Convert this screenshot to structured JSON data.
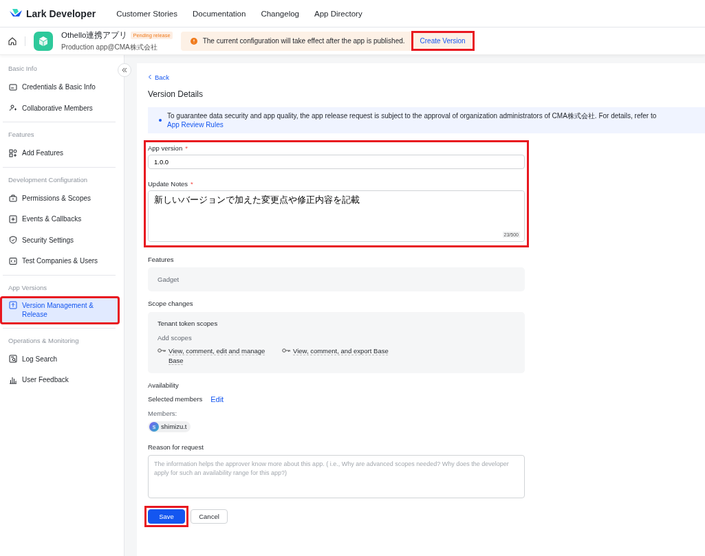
{
  "header": {
    "brand": "Lark Developer",
    "nav": [
      "Customer Stories",
      "Documentation",
      "Changelog",
      "App Directory"
    ]
  },
  "app_bar": {
    "app_name": "Othello連携アプリ",
    "status_badge": "Pending release",
    "subtitle": "Production app@CMA株式会社",
    "notice": "The current configuration will take effect after the app is published.",
    "action": {
      "label": "Create Version",
      "highlighted": true
    }
  },
  "sidebar": {
    "sections": [
      {
        "title": "Basic Info",
        "items": [
          {
            "label": "Credentials & Basic Info",
            "selected": false,
            "highlighted": false
          },
          {
            "label": "Collaborative Members",
            "selected": false,
            "highlighted": false
          }
        ]
      },
      {
        "title": "Features",
        "items": [
          {
            "label": "Add Features",
            "selected": false,
            "highlighted": false
          }
        ]
      },
      {
        "title": "Development Configuration",
        "items": [
          {
            "label": "Permissions & Scopes",
            "selected": false,
            "highlighted": false
          },
          {
            "label": "Events & Callbacks",
            "selected": false,
            "highlighted": false
          },
          {
            "label": "Security Settings",
            "selected": false,
            "highlighted": false
          },
          {
            "label": "Test Companies & Users",
            "selected": false,
            "highlighted": false
          }
        ]
      },
      {
        "title": "App Versions",
        "items": [
          {
            "label": "Version Management & Release",
            "selected": true,
            "highlighted": true
          }
        ]
      },
      {
        "title": "Operations & Monitoring",
        "items": [
          {
            "label": "Log Search",
            "selected": false,
            "highlighted": false
          },
          {
            "label": "User Feedback",
            "selected": false,
            "highlighted": false
          }
        ]
      }
    ]
  },
  "main": {
    "back": "Back",
    "title": "Version Details",
    "notice": {
      "text": "To guarantee data security and app quality, the app release request is subject to the approval of organization administrators of CMA株式会社. For details, refer to",
      "link": "App Review Rules"
    },
    "form": {
      "highlighted": true,
      "fields": [
        {
          "kind": "input",
          "label": "App version",
          "required_mark": "*",
          "value": "1.0.0"
        },
        {
          "kind": "textarea",
          "label": "Update Notes",
          "required_mark": "*",
          "value": "新しいバージョンで加えた変更点や修正内容を記載",
          "counter": "23/500"
        }
      ]
    },
    "features": {
      "label": "Features",
      "items": [
        "Gadget"
      ]
    },
    "scope_changes": {
      "label": "Scope changes",
      "group": "Tenant token scopes",
      "sublabel": "Add scopes",
      "scopes": [
        "View, comment, edit and manage Base",
        "View, comment, and export Base"
      ]
    },
    "availability": {
      "label": "Availability",
      "mode": "Selected members",
      "edit": "Edit",
      "members_label": "Members:",
      "members": [
        {
          "initial": "s",
          "name": "shimizu.t"
        }
      ]
    },
    "reason": {
      "label": "Reason for request",
      "placeholder": "The information helps the approver know more about this app. ( i.e., Why are advanced scopes needed? Why does the developer apply for such an availability range for this app?)"
    },
    "buttons": [
      {
        "kind": "primary",
        "label": "Save",
        "highlighted": true
      },
      {
        "kind": "secondary",
        "label": "Cancel",
        "highlighted": false
      }
    ]
  }
}
